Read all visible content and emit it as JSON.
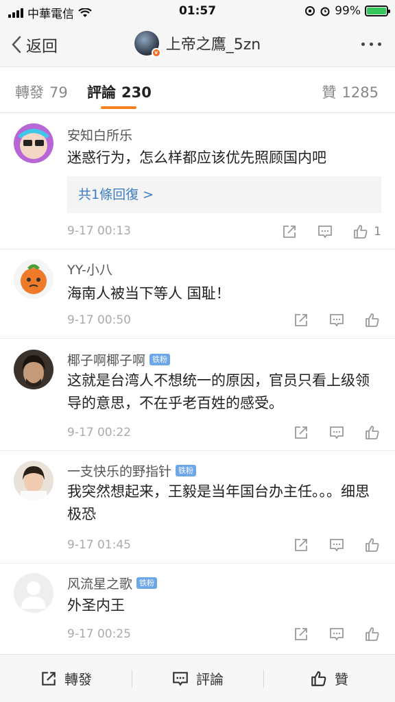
{
  "status": {
    "carrier": "中華電信",
    "time": "01:57",
    "battery": "99%",
    "battery_level": 0.99
  },
  "nav": {
    "back_label": "返回",
    "title": "上帝之鷹_5zn"
  },
  "tabs": [
    {
      "label": "轉發",
      "count": "79"
    },
    {
      "label": "評論",
      "count": "230"
    },
    {
      "label": "贊",
      "count": "1285"
    }
  ],
  "comments": [
    {
      "user": "安知白所乐",
      "badge": "",
      "text": "迷惑行为，怎么样都应该优先照顾国内吧",
      "reply": "共1條回復 >",
      "time": "9-17 00:13",
      "likes": "1"
    },
    {
      "user": "YY-小八",
      "badge": "",
      "text": "海南人被当下等人 国耻！",
      "reply": "",
      "time": "9-17 00:50",
      "likes": ""
    },
    {
      "user": "椰子啊椰子啊",
      "badge": "铁粉",
      "text": "这就是台湾人不想统一的原因，官员只看上级领导的意思，不在乎老百姓的感受。",
      "reply": "",
      "time": "9-17 00:22",
      "likes": ""
    },
    {
      "user": "一支快乐的野指针",
      "badge": "铁粉",
      "text": "我突然想起来，王毅是当年国台办主任。。。细思极恐",
      "reply": "",
      "time": "9-17 01:45",
      "likes": ""
    },
    {
      "user": "风流星之歌",
      "badge": "铁粉",
      "text": "外圣内王",
      "reply": "",
      "time": "9-17 00:25",
      "likes": ""
    }
  ],
  "bottom": {
    "repost": "轉發",
    "comment": "評論",
    "like": "贊"
  },
  "colors": {
    "accent": "#f6821f",
    "link": "#3c7cc4",
    "badge": "#6ea7e8"
  }
}
